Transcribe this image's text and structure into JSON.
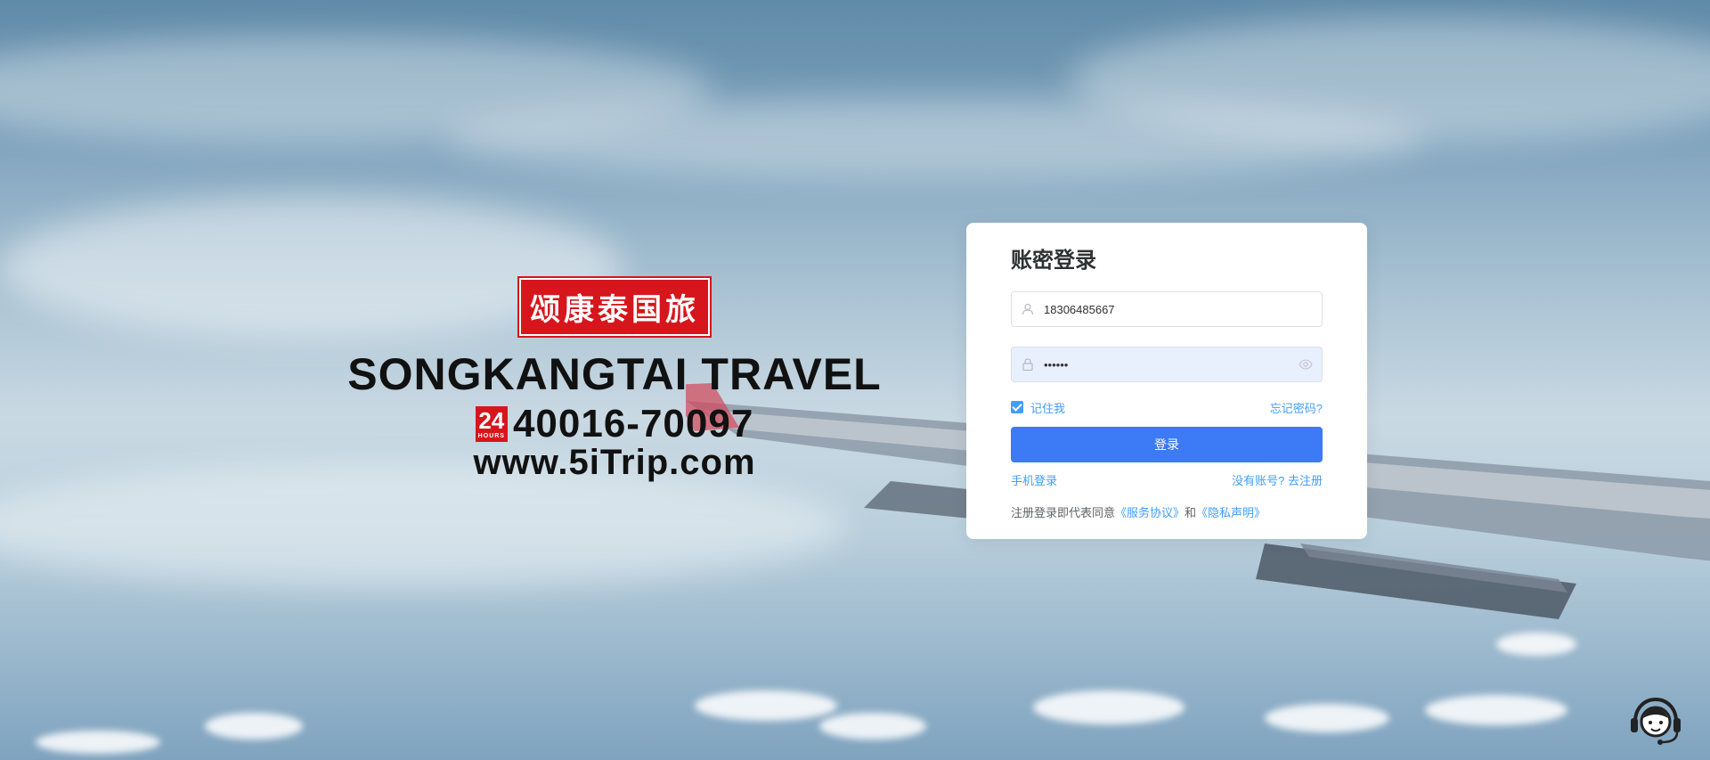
{
  "brand": {
    "name_cn": "颂康泰国旅",
    "name_en": "SONGKANGTAI TRAVEL",
    "badge_number": "24",
    "badge_hours": "HOURS",
    "phone": "40016-70097",
    "url": "www.5iTrip.com",
    "accent_color": "#d6161c"
  },
  "login": {
    "title": "账密登录",
    "account_value": "18306485667",
    "password_value": "••••••",
    "remember_label": "记住我",
    "remember_checked": true,
    "forgot_label": "忘记密码?",
    "submit_label": "登录",
    "phone_login_label": "手机登录",
    "register_label": "没有账号? 去注册",
    "agree_prefix": "注册登录即代表同意",
    "service_agreement": "《服务协议》",
    "and_text": "和",
    "privacy_statement": "《隐私声明》",
    "primary_color": "#3d7af5",
    "link_color": "#409eff"
  },
  "icons": {
    "account": "user-icon",
    "password": "lock-icon",
    "toggle_password": "eye-icon",
    "support": "customer-service-icon"
  }
}
